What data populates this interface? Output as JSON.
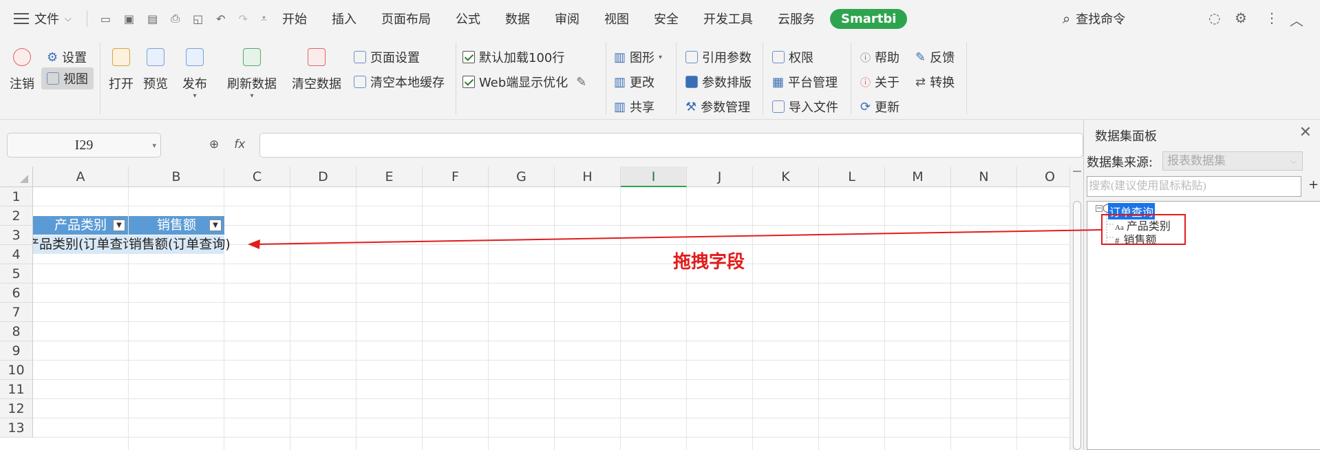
{
  "menu": {
    "file": "文件"
  },
  "tabs": [
    "开始",
    "插入",
    "页面布局",
    "公式",
    "数据",
    "审阅",
    "视图",
    "安全",
    "开发工具",
    "云服务"
  ],
  "smartbi_tab": "Smartbi",
  "search_command": "查找命令",
  "ribbon": {
    "logout": "注销",
    "settings": "设置",
    "view": "视图",
    "open": "打开",
    "preview": "预览",
    "publish": "发布",
    "refresh_data": "刷新数据",
    "clear_data": "清空数据",
    "page_setup": "页面设置",
    "clear_cache": "清空本地缓存",
    "default_load": "默认加载100行",
    "web_optimize": "Web端显示优化",
    "chart": "图形",
    "change": "更改",
    "share": "共享",
    "ref_param": "引用参数",
    "param_layout": "参数排版",
    "param_manage": "参数管理",
    "permission": "权限",
    "platform_manage": "平台管理",
    "import_file": "导入文件",
    "help": "帮助",
    "feedback": "反馈",
    "about": "关于",
    "convert": "转换",
    "update": "更新"
  },
  "formula": {
    "name_box": "I29",
    "fx": "fx"
  },
  "grid": {
    "columns": [
      "A",
      "B",
      "C",
      "D",
      "E",
      "F",
      "G",
      "H",
      "I",
      "J",
      "K",
      "L",
      "M",
      "N",
      "O"
    ],
    "rows": [
      "1",
      "2",
      "3",
      "4",
      "5",
      "6",
      "7",
      "8",
      "9",
      "10",
      "11",
      "12",
      "13"
    ],
    "header_a": "产品类别",
    "header_b": "销售额",
    "cell_a3": "产品类别(订单查询)",
    "cell_b3": "销售额(订单查询)"
  },
  "panel": {
    "title": "数据集面板",
    "source_label": "数据集来源:",
    "source_value": "报表数据集",
    "search_placeholder": "搜索(建议使用鼠标粘贴)",
    "plus": "+",
    "tree_root": "订单查询",
    "field1": "产品类别",
    "field2": "销售额",
    "field1_icon": "Aa",
    "field2_icon": "#"
  },
  "annotation": "拖拽字段",
  "colors": {
    "accent": "#2ea44f",
    "header_blue": "#5b9bd5",
    "annotation_red": "#e21b1b",
    "tree_select": "#1a73e8"
  }
}
